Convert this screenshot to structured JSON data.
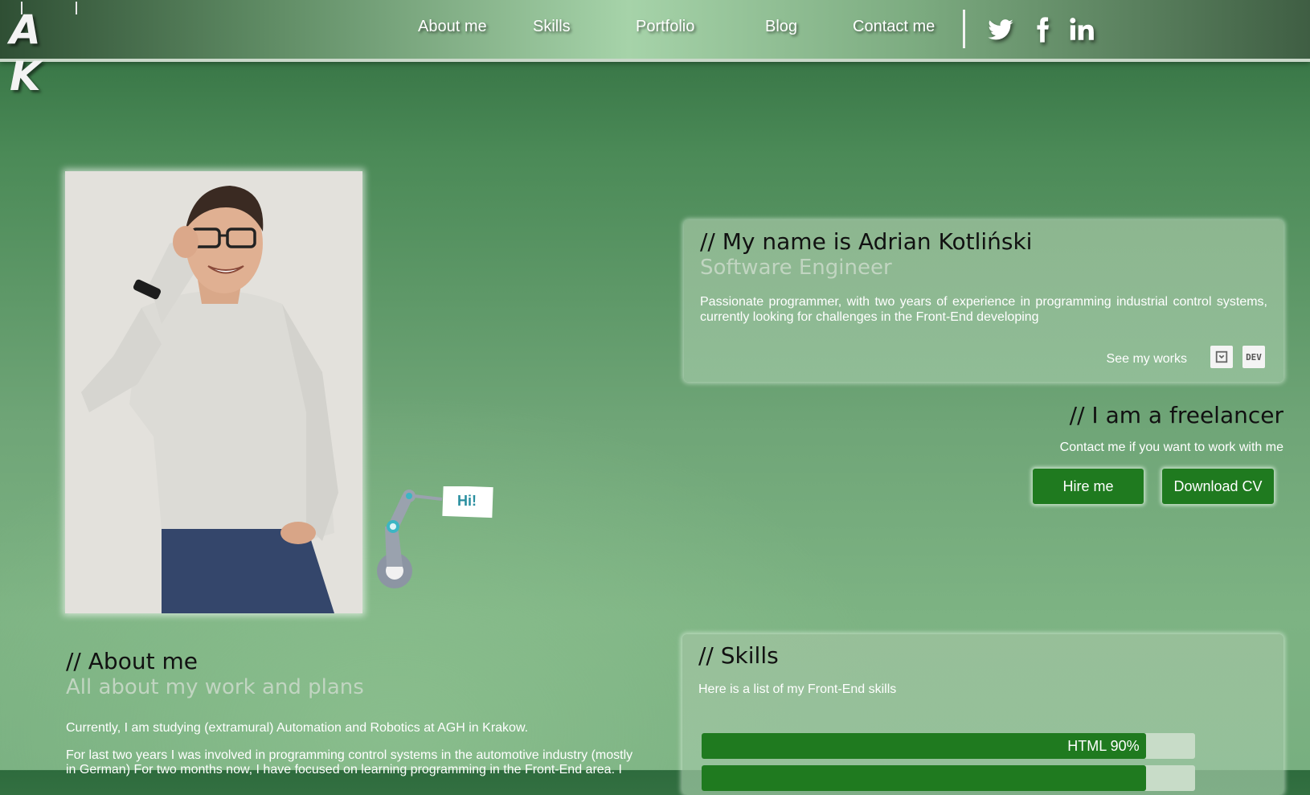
{
  "logo": {
    "text": "A K"
  },
  "nav": {
    "items": [
      {
        "label": "About me"
      },
      {
        "label": "Skills"
      },
      {
        "label": "Portfolio"
      },
      {
        "label": "Blog"
      },
      {
        "label": "Contact me"
      }
    ],
    "social": [
      {
        "icon": "twitter-icon"
      },
      {
        "icon": "facebook-icon"
      },
      {
        "icon": "linkedin-icon"
      }
    ]
  },
  "robot": {
    "speech": "Hi!"
  },
  "intro": {
    "title": "// My name is Adrian Kotliński",
    "subtitle": "Software Engineer",
    "description": "Passionate programmer, with two years of experience in programming industrial control systems, currently looking for challenges in the Front-End developing",
    "works_label": "See my works",
    "work_icons": [
      {
        "icon": "codepen-icon",
        "text": ""
      },
      {
        "icon": "dev-icon",
        "text": "DEV"
      }
    ]
  },
  "freelance": {
    "title": "// I am a freelancer",
    "subtitle": "Contact me if you want to work with me",
    "hire_label": "Hire me",
    "cv_label": "Download CV"
  },
  "about": {
    "title": "// About me",
    "subtitle": "All about my work and plans",
    "p1": "Currently, I am studying (extramural) Automation and Robotics at AGH in Krakow.",
    "p2": "For last two years I was involved in programming control systems in the automotive industry (mostly in German) For two months now, I have focused on learning programming in the Front-End area. I"
  },
  "skills": {
    "title": "// Skills",
    "lead": "Here is a list of my Front-End skills",
    "items": [
      {
        "label": "HTML 90%",
        "percent": 90
      },
      {
        "label": "",
        "percent": 90
      }
    ]
  },
  "colors": {
    "accent": "#1f7a1f",
    "header": "#5e8a63"
  }
}
